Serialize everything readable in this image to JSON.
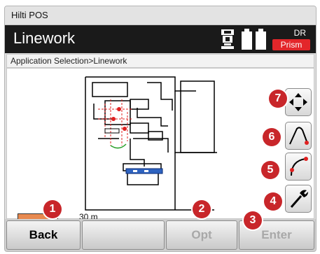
{
  "window": {
    "title": "Hilti POS"
  },
  "header": {
    "title": "Linework",
    "mode_label": "DR",
    "target_label": "Prism"
  },
  "breadcrumb": {
    "text": "Application Selection>Linework"
  },
  "map": {
    "scale_label": "30 m"
  },
  "footer": {
    "back_label": "Back",
    "opt_label": "Opt",
    "enter_label": "Enter"
  },
  "callouts": {
    "c1": "1",
    "c2": "2",
    "c3": "3",
    "c4": "4",
    "c5": "5",
    "c6": "6",
    "c7": "7"
  },
  "side_buttons": [
    "pan-view",
    "arc-line",
    "curve-line",
    "settings-tools"
  ],
  "colors": {
    "header_bg": "#1a1a1a",
    "prism_badge": "#e3262a",
    "callout": "#c8262a",
    "scale_bar": "#e8894f"
  }
}
